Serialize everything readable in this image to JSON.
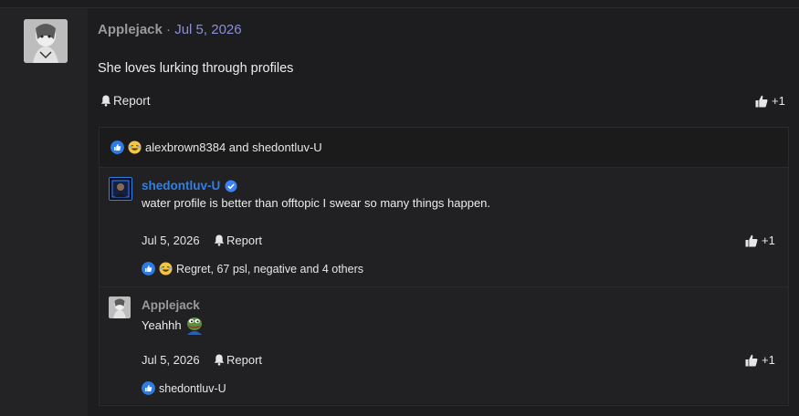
{
  "post": {
    "author": "Applejack",
    "separator": " · ",
    "date": "Jul 5, 2026",
    "text": "She loves lurking through profiles",
    "report_label": "Report",
    "like_count": "+1"
  },
  "reactions_summary": {
    "text": "alexbrown8384 and shedontluv-U"
  },
  "replies": [
    {
      "author": "shedontluv-U",
      "text": "water profile is better than offtopic I swear so many things happen.",
      "date": "Jul 5, 2026",
      "report_label": "Report",
      "like_count": "+1",
      "reactions": "Regret, 67 psl, negative and 4 others"
    },
    {
      "author": "Applejack",
      "text": "Yeahhh",
      "date": "Jul 5, 2026",
      "report_label": "Report",
      "like_count": "+1",
      "reactions": "shedontluv-U"
    }
  ],
  "colors": {
    "accent_link": "#8a8fd6",
    "verified": "#3b82f6",
    "username_blue": "#2f7fe6"
  }
}
